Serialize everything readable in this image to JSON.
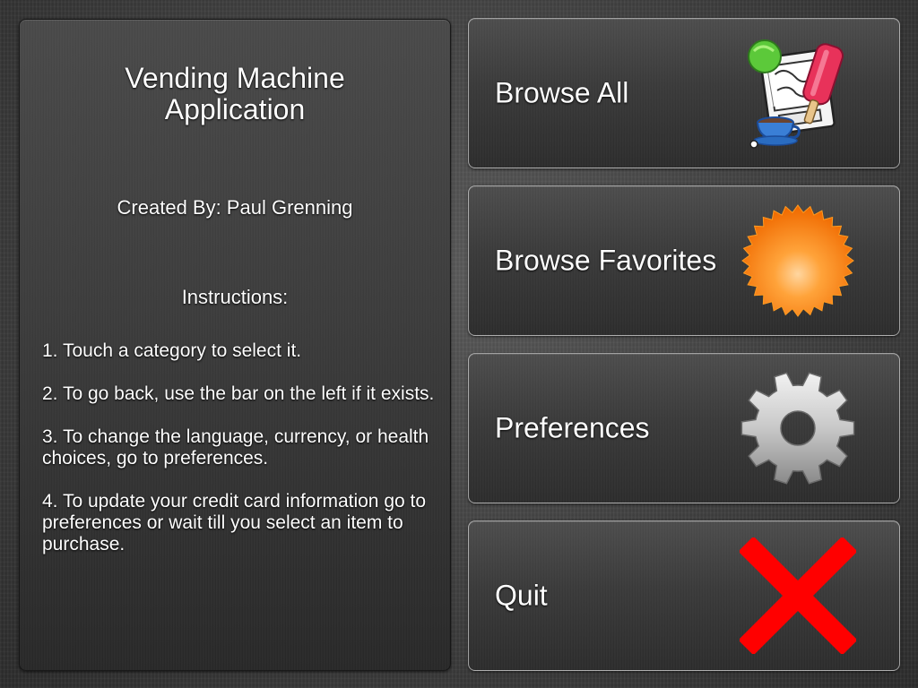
{
  "info": {
    "title_line1": "Vending Machine",
    "title_line2": "Application",
    "author": "Created By: Paul Grenning",
    "instructions_heading": "Instructions:",
    "instructions": [
      "1. Touch a category to select it.",
      "2. To go back, use the bar on the left if it exists.",
      "3. To change the language, currency, or health choices, go to preferences.",
      "4. To update your credit card information go to preferences or wait till you select an item to purchase."
    ]
  },
  "menu": {
    "browse_all": {
      "label": "Browse All",
      "icon": "snacks-icon"
    },
    "browse_favorites": {
      "label": "Browse Favorites",
      "icon": "starburst-icon"
    },
    "preferences": {
      "label": "Preferences",
      "icon": "gear-icon"
    },
    "quit": {
      "label": "Quit",
      "icon": "red-x-icon"
    }
  },
  "colors": {
    "panel_border": "#c8c8c8",
    "text": "#ffffff",
    "quit_x": "#ff0000",
    "starburst": "#ff8a1e"
  }
}
